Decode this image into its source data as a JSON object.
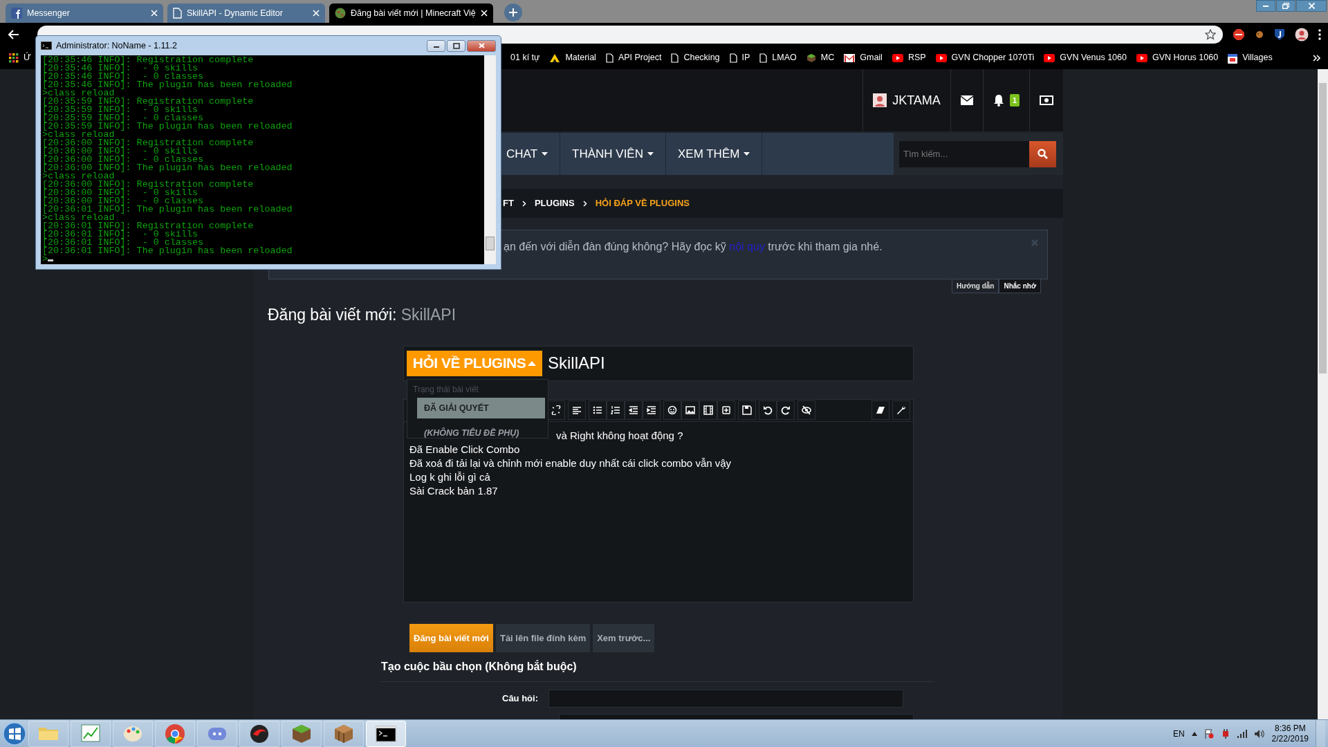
{
  "browser": {
    "tabs": [
      {
        "title": "Messenger",
        "kind": "facebook",
        "selected": false
      },
      {
        "title": "SkillAPI - Dynamic Editor",
        "kind": "page",
        "selected": false
      },
      {
        "title": "Đăng bài viết mới | Minecraft Việ",
        "kind": "globe",
        "selected": true
      }
    ],
    "bookmarks": [
      {
        "label": "Ứ",
        "kind": "apps"
      },
      {
        "label": "01 kí tự",
        "kind": "plain"
      },
      {
        "label": "Material",
        "kind": "material"
      },
      {
        "label": "API Project",
        "kind": "page"
      },
      {
        "label": "Checking",
        "kind": "page"
      },
      {
        "label": "IP",
        "kind": "page"
      },
      {
        "label": "LMAO",
        "kind": "page"
      },
      {
        "label": "MC",
        "kind": "cube"
      },
      {
        "label": "Gmail",
        "kind": "mail"
      },
      {
        "label": "RSP",
        "kind": "video"
      },
      {
        "label": "GVN Chopper 1070Ti",
        "kind": "video"
      },
      {
        "label": "GVN Venus 1060",
        "kind": "video"
      },
      {
        "label": "GVN Horus 1060",
        "kind": "video"
      },
      {
        "label": "Villages",
        "kind": "calendar"
      }
    ]
  },
  "console": {
    "title": "Administrator:  NoName - 1.11.2",
    "lines": [
      "[20:35:46 INFO]: Registration complete",
      "[20:35:46 INFO]:  - 0 skills",
      "[20:35:46 INFO]:  - 0 classes",
      "[20:35:46 INFO]: The plugin has been reloaded",
      ">class reload",
      "[20:35:59 INFO]: Registration complete",
      "[20:35:59 INFO]:  - 0 skills",
      "[20:35:59 INFO]:  - 0 classes",
      "[20:35:59 INFO]: The plugin has been reloaded",
      ">class reload",
      "[20:36:00 INFO]: Registration complete",
      "[20:36:00 INFO]:  - 0 skills",
      "[20:36:00 INFO]:  - 0 classes",
      "[20:36:00 INFO]: The plugin has been reloaded",
      ">class reload",
      "[20:36:00 INFO]: Registration complete",
      "[20:36:00 INFO]:  - 0 skills",
      "[20:36:00 INFO]:  - 0 classes",
      "[20:36:01 INFO]: The plugin has been reloaded",
      ">class reload",
      "[20:36:01 INFO]: Registration complete",
      "[20:36:01 INFO]:  - 0 skills",
      "[20:36:01 INFO]:  - 0 classes",
      "[20:36:01 INFO]: The plugin has been reloaded"
    ],
    "prompt": ">"
  },
  "forum": {
    "user": "JKTAMA",
    "alerts": "1",
    "nav": [
      {
        "label": "CHAT"
      },
      {
        "label": "THÀNH VIÊN"
      },
      {
        "label": "XEM THÊM"
      }
    ],
    "search": {
      "placeholder": "Tìm kiếm..."
    },
    "breadcrumb": [
      {
        "label": "FT",
        "current": false
      },
      {
        "label": "PLUGINS",
        "current": false
      },
      {
        "label": "HỎI ĐÁP VỀ PLUGINS",
        "current": true
      }
    ],
    "notice": {
      "before": "ạn đến với diễn đàn đúng không? Hãy đọc kỹ ",
      "link": "nội quy",
      "after": " trước khi tham gia nhé."
    },
    "notice_tabs": [
      {
        "label": "Hướng dẫn",
        "selected": false
      },
      {
        "label": "Nhắc nhở",
        "selected": true
      }
    ],
    "page_title": "Đăng bài viết mới:",
    "page_subject": "SkillAPI",
    "prefix": {
      "label": "HỎI VỀ PLUGINS",
      "expanded": true
    },
    "title_value": "SkillAPI",
    "prefix_menu": {
      "header": "Trạng thái bài viết",
      "items": [
        {
          "label": "ĐÃ GIẢI QUYẾT",
          "selected": true
        },
        {
          "label": "(KHÔNG TIÊU ĐỀ PHỤ)",
          "selected": false
        }
      ]
    },
    "editor_lines": [
      "và Right không hoạt động ?",
      "Đã Enable Click Combo",
      "Đã xoá đi tải lại và chỉnh mới enable duy nhất cái click combo vẫn vậy",
      "Log k ghi lỗi gì cả",
      "Sài Crack bản 1.87"
    ],
    "buttons": [
      {
        "label": "Đăng bài viết mới",
        "kind": "primary"
      },
      {
        "label": "Tải lên file đính kèm",
        "kind": "secondary"
      },
      {
        "label": "Xem trước...",
        "kind": "secondary"
      }
    ],
    "poll": {
      "heading": "Tạo cuộc bầu chọn (Không bắt buộc)",
      "question_label": "Câu hỏi:"
    }
  },
  "taskbar": {
    "apps": [
      {
        "kind": "folder",
        "selected": false
      },
      {
        "kind": "chart",
        "selected": false
      },
      {
        "kind": "paint",
        "selected": false
      },
      {
        "kind": "chrome",
        "selected": false
      },
      {
        "kind": "discord",
        "selected": false
      },
      {
        "kind": "garena",
        "selected": false
      },
      {
        "kind": "grass",
        "selected": false
      },
      {
        "kind": "crate",
        "selected": false
      },
      {
        "kind": "terminal",
        "selected": true
      }
    ],
    "lang": "EN",
    "time": "8:36 PM",
    "date": "2/22/2019"
  }
}
